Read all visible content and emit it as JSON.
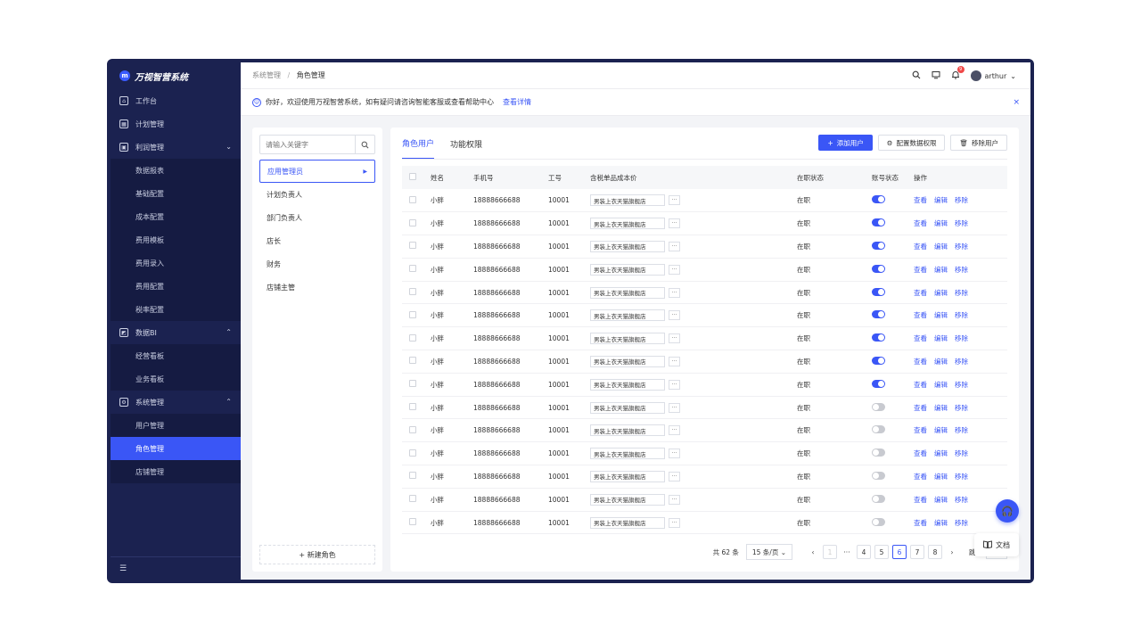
{
  "app": {
    "title": "万视智营系统",
    "logo_text": "m"
  },
  "sidebar": {
    "items": [
      {
        "label": "工作台",
        "icon": "home-icon",
        "glyph": "⌂"
      },
      {
        "label": "计划管理",
        "icon": "calendar-icon",
        "glyph": "▦"
      },
      {
        "label": "利润管理",
        "icon": "wallet-icon",
        "glyph": "▣",
        "chev": "⌄",
        "children": [
          "数据报表",
          "基础配置",
          "成本配置",
          "费用模板",
          "费用录入",
          "费用配置",
          "税率配置"
        ]
      },
      {
        "label": "数据BI",
        "icon": "chart-icon",
        "glyph": "◩",
        "chev": "⌃",
        "children": [
          "经营看板",
          "业务看板"
        ]
      },
      {
        "label": "系统管理",
        "icon": "gear-icon",
        "glyph": "⚙",
        "chev": "⌃",
        "children": [
          "用户管理",
          "角色管理",
          "店铺管理"
        ]
      }
    ],
    "active_child": "角色管理",
    "collapse_glyph": "☰"
  },
  "header": {
    "breadcrumb": [
      "系统管理",
      "角色管理"
    ],
    "separator": "/",
    "notif_count": "9",
    "username": "arthur",
    "user_chev": "⌄"
  },
  "notice": {
    "text": "你好，欢迎使用万视智营系统，如有疑问请咨询智能客服或查看帮助中心",
    "link": "查看详情",
    "close": "×"
  },
  "roles": {
    "search_placeholder": "请输入关键字",
    "items": [
      "应用管理员",
      "计划负责人",
      "部门负责人",
      "店长",
      "财务",
      "店铺主管"
    ],
    "active": "应用管理员",
    "new_role": "+ 新建角色"
  },
  "tabs": [
    "角色用户",
    "功能权限"
  ],
  "active_tab": "角色用户",
  "toolbar": {
    "add_user": "添加用户",
    "config_perm": "配置数据权限",
    "remove_user": "移除用户"
  },
  "table": {
    "columns": [
      "姓名",
      "手机号",
      "工号",
      "含税单品成本价",
      "在职状态",
      "账号状态",
      "操作"
    ],
    "row_template": {
      "name": "小胖",
      "phone": "18888666688",
      "emp_no": "10001",
      "cost": "男装上衣天猫旗舰店",
      "more": "···",
      "status": "在职"
    },
    "account_enabled": [
      true,
      true,
      true,
      true,
      true,
      true,
      true,
      true,
      true,
      false,
      false,
      false,
      false,
      false,
      false
    ],
    "ops": [
      "查看",
      "编辑",
      "移除"
    ]
  },
  "pagination": {
    "total": "共 62 条",
    "page_size": "15 条/页 ⌄",
    "prev": "‹",
    "next": "›",
    "first": "1",
    "ellipsis": "···",
    "pages": [
      "4",
      "5",
      "6",
      "7",
      "8"
    ],
    "current": "6",
    "jump_label": "跳至"
  },
  "float": {
    "docs_label": "文档"
  }
}
